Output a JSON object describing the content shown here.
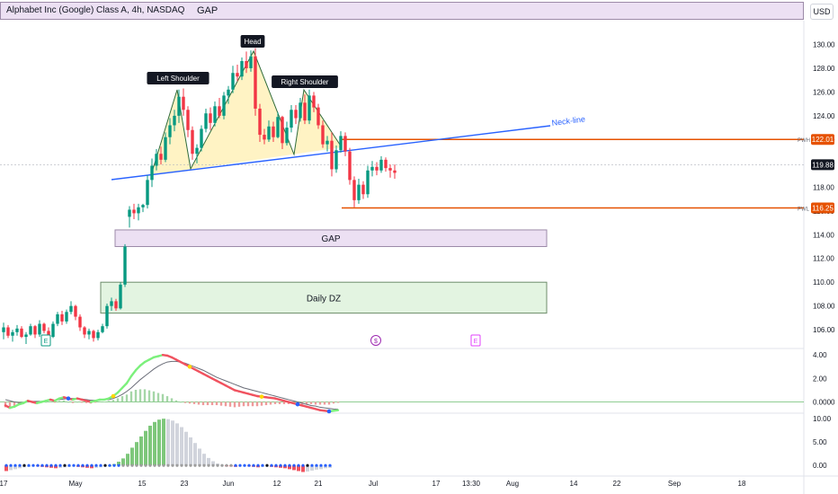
{
  "header": {
    "title": "Alphabet Inc (Google) Class A, 4h, NASDAQ",
    "gap_label": "GAP",
    "currency": "USD"
  },
  "colors": {
    "up": "#089981",
    "down": "#f23645",
    "pattern_fill": "#fff3c4",
    "neckline": "#2962ff",
    "level": "#e65100",
    "gap_fill": "#ece0f3",
    "dz_fill": "#e3f4e1",
    "signal_green": "#7cf07c",
    "signal_red": "#f0525f"
  },
  "chart_data": [
    {
      "type": "candlestick",
      "title": "Alphabet Inc (Google) Class A, 4h, NASDAQ",
      "ylim": [
        104.5,
        132
      ],
      "y_ticks": [
        106,
        108,
        110,
        112,
        114,
        116,
        118,
        120,
        122,
        124,
        126,
        128,
        130
      ],
      "x_ticks": [
        "17",
        "May",
        "15",
        "23",
        "Jun",
        "12",
        "21",
        "Jul",
        "17",
        "13:30",
        "Aug",
        "14",
        "22",
        "Sep",
        "18"
      ],
      "price_labels": [
        {
          "text": "PWH",
          "value": "122.01",
          "price": 122.01
        },
        {
          "text": "",
          "value": "119.88",
          "price": 119.88
        },
        {
          "text": "PWL",
          "value": "116.25",
          "price": 116.25
        }
      ],
      "pattern_labels": [
        "Left Shoulder",
        "Head",
        "Right Shoulder"
      ],
      "neckline_label": "Neck-line",
      "zones": [
        {
          "label": "GAP",
          "low": 113.0,
          "high": 114.4
        },
        {
          "label": "Daily DZ",
          "low": 107.4,
          "high": 110.0
        }
      ],
      "event_markers": [
        "$",
        "E"
      ],
      "candles": [
        [
          105.8,
          106.6,
          105.2,
          106.2
        ],
        [
          106.2,
          106.4,
          105.3,
          105.5
        ],
        [
          105.5,
          106.0,
          105.0,
          105.8
        ],
        [
          105.8,
          106.4,
          105.5,
          106.1
        ],
        [
          106.1,
          106.3,
          105.3,
          105.4
        ],
        [
          105.4,
          105.8,
          104.8,
          105.6
        ],
        [
          105.6,
          106.5,
          105.5,
          106.3
        ],
        [
          106.3,
          106.4,
          105.3,
          105.6
        ],
        [
          105.6,
          106.8,
          105.4,
          106.5
        ],
        [
          106.5,
          106.6,
          105.7,
          105.9
        ],
        [
          105.9,
          106.2,
          105.2,
          105.4
        ],
        [
          105.4,
          106.7,
          105.3,
          106.5
        ],
        [
          106.5,
          107.5,
          106.3,
          107.3
        ],
        [
          107.3,
          107.6,
          106.4,
          106.7
        ],
        [
          106.7,
          107.7,
          106.5,
          107.5
        ],
        [
          107.5,
          108.4,
          107.3,
          108.0
        ],
        [
          108.0,
          108.1,
          106.8,
          107.1
        ],
        [
          107.1,
          107.3,
          105.9,
          106.2
        ],
        [
          106.2,
          106.3,
          105.3,
          105.6
        ],
        [
          105.6,
          106.1,
          105.2,
          105.9
        ],
        [
          105.9,
          106.0,
          105.0,
          105.3
        ],
        [
          105.3,
          106.0,
          105.1,
          105.8
        ],
        [
          105.8,
          106.5,
          105.7,
          106.3
        ],
        [
          106.3,
          108.2,
          106.1,
          108.0
        ],
        [
          108.0,
          108.7,
          107.6,
          108.4
        ],
        [
          108.4,
          108.6,
          107.6,
          107.8
        ],
        [
          107.8,
          110.0,
          107.7,
          109.8
        ],
        [
          109.8,
          113.2,
          109.6,
          113.0
        ],
        [
          115.5,
          116.4,
          114.6,
          116.1
        ],
        [
          116.1,
          116.6,
          115.3,
          115.8
        ],
        [
          115.8,
          116.6,
          115.2,
          116.3
        ],
        [
          116.3,
          116.6,
          115.9,
          116.5
        ],
        [
          116.5,
          119.0,
          116.2,
          118.6
        ],
        [
          118.6,
          120.4,
          118.0,
          119.8
        ],
        [
          119.8,
          121.2,
          119.4,
          120.8
        ],
        [
          120.8,
          121.4,
          119.9,
          120.3
        ],
        [
          120.3,
          122.6,
          120.1,
          122.2
        ],
        [
          122.2,
          123.8,
          121.6,
          123.2
        ],
        [
          123.2,
          124.5,
          122.7,
          124.0
        ],
        [
          124.0,
          126.2,
          123.4,
          125.6
        ],
        [
          125.6,
          126.3,
          124.0,
          124.5
        ],
        [
          124.5,
          124.8,
          122.2,
          122.8
        ],
        [
          122.8,
          123.1,
          120.3,
          120.8
        ],
        [
          120.8,
          121.6,
          120.0,
          121.3
        ],
        [
          121.3,
          123.2,
          121.0,
          122.9
        ],
        [
          122.9,
          124.6,
          122.6,
          124.2
        ],
        [
          124.2,
          124.7,
          122.8,
          123.4
        ],
        [
          123.4,
          125.2,
          123.1,
          124.8
        ],
        [
          124.8,
          125.5,
          123.8,
          124.0
        ],
        [
          124.0,
          126.0,
          123.7,
          125.7
        ],
        [
          125.7,
          126.5,
          125.0,
          126.2
        ],
        [
          126.2,
          128.2,
          125.9,
          127.6
        ],
        [
          127.6,
          128.3,
          126.9,
          127.3
        ],
        [
          127.3,
          128.9,
          127.0,
          128.6
        ],
        [
          128.6,
          129.4,
          127.6,
          128.0
        ],
        [
          128.0,
          129.5,
          127.7,
          129.0
        ],
        [
          129.0,
          129.7,
          124.0,
          124.6
        ],
        [
          124.6,
          125.0,
          121.8,
          122.4
        ],
        [
          122.4,
          122.9,
          121.6,
          122.0
        ],
        [
          122.0,
          123.6,
          121.8,
          123.1
        ],
        [
          123.1,
          123.5,
          121.8,
          122.2
        ],
        [
          122.2,
          124.3,
          122.1,
          123.9
        ],
        [
          123.9,
          124.0,
          121.2,
          121.7
        ],
        [
          121.7,
          123.5,
          121.5,
          123.0
        ],
        [
          123.0,
          124.9,
          122.6,
          124.5
        ],
        [
          124.5,
          124.9,
          123.3,
          123.8
        ],
        [
          123.8,
          125.5,
          123.5,
          125.1
        ],
        [
          125.1,
          125.8,
          123.3,
          123.6
        ],
        [
          123.6,
          126.2,
          123.3,
          125.7
        ],
        [
          125.7,
          126.0,
          124.3,
          124.7
        ],
        [
          124.7,
          125.0,
          122.9,
          123.2
        ],
        [
          123.2,
          123.6,
          121.3,
          121.6
        ],
        [
          121.6,
          122.3,
          121.0,
          121.9
        ],
        [
          121.9,
          122.6,
          118.9,
          119.5
        ],
        [
          119.5,
          121.5,
          119.2,
          121.1
        ],
        [
          121.1,
          122.7,
          120.9,
          122.3
        ],
        [
          122.3,
          122.6,
          120.6,
          121.0
        ],
        [
          121.0,
          121.3,
          118.2,
          118.6
        ],
        [
          118.6,
          118.9,
          116.3,
          116.9
        ],
        [
          116.9,
          118.7,
          116.6,
          118.2
        ],
        [
          118.2,
          118.5,
          117.0,
          117.4
        ],
        [
          117.4,
          119.8,
          117.1,
          119.4
        ],
        [
          119.4,
          120.2,
          118.9,
          119.7
        ],
        [
          119.7,
          120.1,
          119.0,
          119.4
        ],
        [
          119.4,
          120.6,
          119.2,
          120.3
        ],
        [
          120.3,
          120.5,
          119.3,
          119.6
        ],
        [
          119.6,
          119.9,
          118.8,
          119.4
        ],
        [
          119.4,
          119.9,
          118.7,
          119.2
        ]
      ]
    },
    {
      "type": "line",
      "name": "oscillator",
      "ylim": [
        -0.8,
        4.4
      ],
      "y_ticks": [
        "0.0000",
        "2.00",
        "4.00"
      ],
      "fast": [
        -0.3,
        -0.5,
        -0.4,
        -0.2,
        -0.1,
        0.1,
        0.0,
        -0.1,
        0.0,
        0.1,
        0.2,
        0.1,
        0.3,
        0.4,
        0.3,
        0.2,
        0.3,
        0.2,
        0.1,
        0.0,
        0.1,
        0.2,
        0.2,
        0.3,
        0.5,
        0.8,
        1.2,
        1.6,
        2.2,
        2.7,
        3.1,
        3.4,
        3.6,
        3.8,
        3.9,
        4.0,
        3.95,
        3.8,
        3.6,
        3.4,
        3.2,
        3.0,
        2.8,
        2.6,
        2.4,
        2.2,
        2.0,
        1.8,
        1.6,
        1.4,
        1.2,
        1.0,
        0.9,
        0.8,
        0.7,
        0.6,
        0.5,
        0.45,
        0.4,
        0.35,
        0.3,
        0.2,
        0.1,
        0.0,
        -0.1,
        -0.2,
        -0.3,
        -0.4,
        -0.5,
        -0.6,
        -0.7,
        -0.75,
        -0.8,
        -0.75,
        -0.7
      ],
      "signal": [
        0.2,
        0.1,
        0.0,
        -0.05,
        -0.05,
        0.0,
        0.05,
        0.05,
        0.05,
        0.1,
        0.15,
        0.15,
        0.2,
        0.25,
        0.3,
        0.3,
        0.3,
        0.25,
        0.2,
        0.15,
        0.15,
        0.15,
        0.18,
        0.2,
        0.3,
        0.45,
        0.65,
        0.9,
        1.2,
        1.55,
        1.9,
        2.2,
        2.5,
        2.8,
        3.05,
        3.25,
        3.4,
        3.45,
        3.45,
        3.4,
        3.3,
        3.15,
        3.0,
        2.85,
        2.7,
        2.5,
        2.3,
        2.1,
        1.95,
        1.8,
        1.65,
        1.5,
        1.35,
        1.2,
        1.1,
        1.0,
        0.9,
        0.8,
        0.7,
        0.6,
        0.5,
        0.4,
        0.3,
        0.2,
        0.1,
        0.0,
        -0.1,
        -0.2,
        -0.3,
        -0.35,
        -0.45,
        -0.5,
        -0.55,
        -0.6,
        -0.62
      ]
    },
    {
      "type": "bar",
      "name": "momentum",
      "ylim": [
        -1.5,
        10.8
      ],
      "y_ticks": [
        "0.00",
        "5.00",
        "10.00"
      ],
      "values": [
        -1.2,
        -1.0,
        -0.8,
        -0.6,
        -0.4,
        -0.3,
        -0.2,
        -0.2,
        -0.3,
        -0.4,
        -0.5,
        -0.6,
        -0.5,
        -0.4,
        -0.3,
        -0.2,
        -0.3,
        -0.4,
        -0.5,
        -0.6,
        -0.5,
        -0.4,
        -0.2,
        0.0,
        0.3,
        0.8,
        1.5,
        2.5,
        3.8,
        5.0,
        6.2,
        7.4,
        8.5,
        9.3,
        9.8,
        10.0,
        9.9,
        9.6,
        9.0,
        8.2,
        7.2,
        6.0,
        4.8,
        3.6,
        2.5,
        1.6,
        0.9,
        0.4,
        0.1,
        -0.1,
        -0.2,
        -0.3,
        -0.2,
        -0.1,
        -0.2,
        -0.3,
        -0.4,
        -0.3,
        -0.2,
        -0.3,
        -0.4,
        -0.5,
        -0.6,
        -0.8,
        -1.0,
        -1.2,
        -1.4,
        -1.3,
        -1.1,
        -0.9,
        -0.8,
        -0.6,
        -0.5
      ]
    }
  ]
}
